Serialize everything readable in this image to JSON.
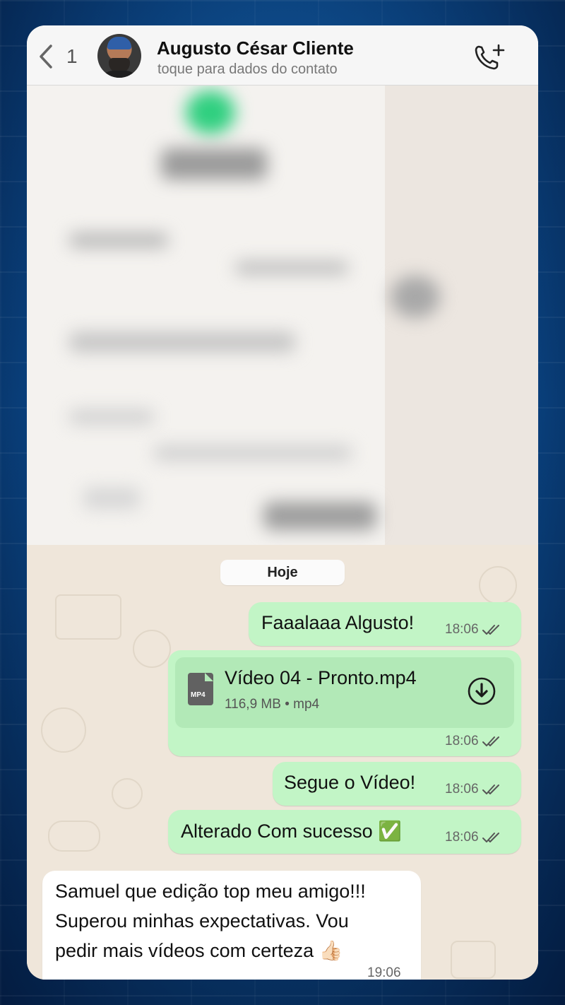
{
  "header": {
    "back_count": "1",
    "contact_name": "Augusto César Cliente",
    "contact_subtitle": "toque para dados do contato",
    "avatar_icon": "avatar",
    "call_icon": "add-call-icon"
  },
  "chat": {
    "date_separator": "Hoje",
    "messages": [
      {
        "direction": "out",
        "type": "text",
        "text": "Faaalaaa Algusto!",
        "time": "18:06",
        "status": "read"
      },
      {
        "direction": "out",
        "type": "file",
        "file_icon_label": "MP4",
        "file_name": "Vídeo 04 - Pronto.mp4",
        "file_meta": "116,9 MB • mp4",
        "time": "18:06",
        "status": "read"
      },
      {
        "direction": "out",
        "type": "text",
        "text": "Segue o Vídeo!",
        "time": "18:06",
        "status": "read"
      },
      {
        "direction": "out",
        "type": "text",
        "text": "Alterado Com sucesso ✅",
        "time": "18:06",
        "status": "read"
      },
      {
        "direction": "in",
        "type": "text",
        "lines": [
          "Samuel que edição top meu amigo!!!",
          "Superou minhas expectativas. Vou",
          "pedir mais vídeos com certeza 👍🏻"
        ],
        "time": "19:06"
      }
    ]
  },
  "colors": {
    "outgoing_bubble": "#c2f5c6",
    "incoming_bubble": "#ffffff",
    "chat_background": "#efe6da",
    "frame_background": "#0b3a66"
  }
}
